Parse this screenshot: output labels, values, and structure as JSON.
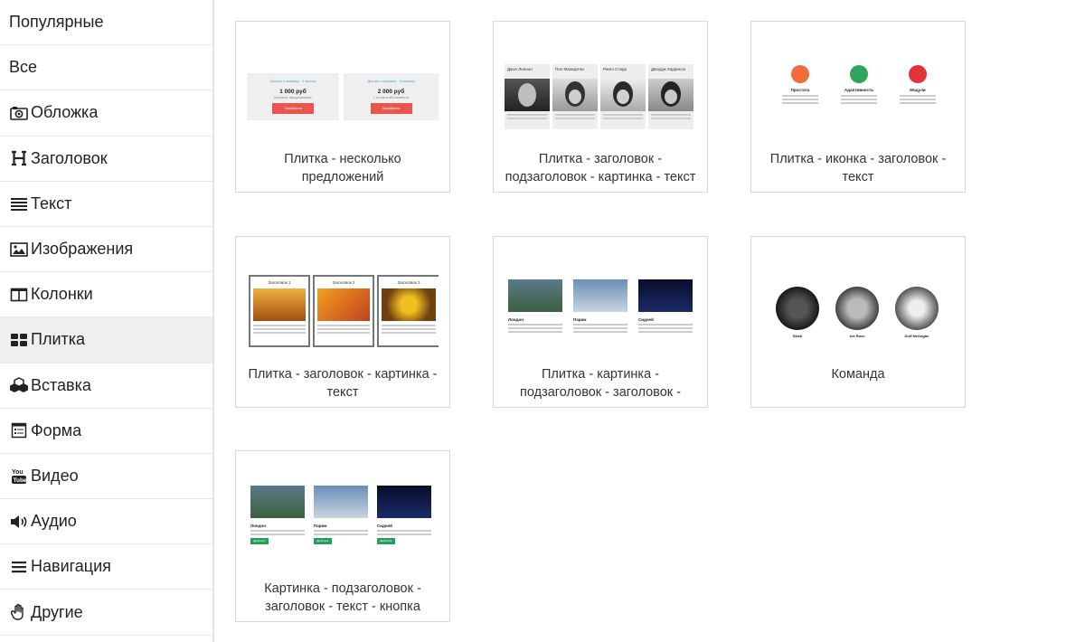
{
  "sidebar": {
    "items": [
      {
        "label": "Популярные",
        "icon": "none"
      },
      {
        "label": "Все",
        "icon": "none"
      },
      {
        "label": "Обложка",
        "icon": "camera-icon"
      },
      {
        "label": "Заголовок",
        "icon": "header-icon"
      },
      {
        "label": "Текст",
        "icon": "text-lines-icon"
      },
      {
        "label": "Изображения",
        "icon": "image-icon"
      },
      {
        "label": "Колонки",
        "icon": "columns-icon"
      },
      {
        "label": "Плитка",
        "icon": "grid-icon",
        "active": true
      },
      {
        "label": "Вставка",
        "icon": "cubes-icon"
      },
      {
        "label": "Форма",
        "icon": "form-icon"
      },
      {
        "label": "Видео",
        "icon": "youtube-icon"
      },
      {
        "label": "Аудио",
        "icon": "speaker-icon"
      },
      {
        "label": "Навигация",
        "icon": "hamburger-icon"
      },
      {
        "label": "Другие",
        "icon": "hand-icon"
      }
    ]
  },
  "cards": [
    {
      "caption": "Плитка - несколько предложений",
      "thumb": {
        "offers": [
          {
            "title": "Доступ к сервису - 1 месяц",
            "price": "1 000 руб",
            "sub": "Базовое предложение",
            "button": "Приобрести"
          },
          {
            "title": "Доступ к сервису - 3 месяца",
            "price": "2 000 руб",
            "sub": "+ оплата абонемента",
            "button": "Приобрести"
          }
        ]
      }
    },
    {
      "caption": "Плитка - заголовок - подзаголовок - картинка - текст",
      "thumb": {
        "people": [
          "Джон Леннон",
          "Пол Маккартни",
          "Ринго Старр",
          "Джордж Харрисон"
        ]
      }
    },
    {
      "caption": "Плитка - иконка - заголовок - текст",
      "thumb": {
        "features": [
          {
            "title": "Простота",
            "color": "#f26b3a"
          },
          {
            "title": "Адаптивность",
            "color": "#2ea55a"
          },
          {
            "title": "Модули",
            "color": "#e0343b"
          }
        ]
      }
    },
    {
      "caption": "Плитка - заголовок - картинка - текст",
      "thumb": {
        "tiles": [
          "Заголовок 1",
          "Заголовок 2",
          "Заголовок 3"
        ]
      }
    },
    {
      "caption": "Плитка - картинка - подзаголовок - заголовок -",
      "thumb": {
        "cities": [
          "Лондон",
          "Париж",
          "Сидней"
        ]
      }
    },
    {
      "caption": "Команда",
      "thumb": {
        "members": [
          "Slash",
          "Axl Rose",
          "Duff McKagan"
        ]
      }
    },
    {
      "caption": "Картинка - подзаголовок - заголовок - текст - кнопка",
      "thumb": {
        "cities": [
          "Лондон",
          "Париж",
          "Сидней"
        ],
        "button": "Действие"
      }
    }
  ],
  "colors": {
    "accent_red": "#e8554e",
    "accent_blue": "#3aa5d8",
    "accent_green": "#25a05b",
    "active_bg": "#efefef"
  }
}
